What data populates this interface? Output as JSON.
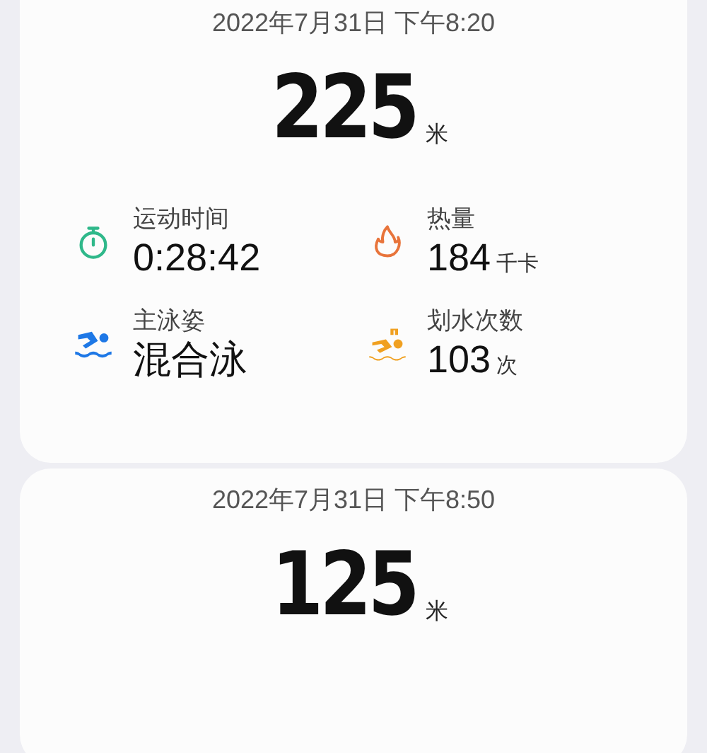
{
  "records": [
    {
      "datetime": "2022年7月31日 下午8:20",
      "distance": "225",
      "distance_unit": "米",
      "stats": [
        {
          "kind": "stopwatch",
          "label": "运动时间",
          "value": "0:28:42"
        },
        {
          "kind": "flame",
          "label": "热量",
          "value": "184",
          "unit": "千卡"
        },
        {
          "kind": "swimmer",
          "label": "主泳姿",
          "value": "混合泳"
        },
        {
          "kind": "strokes",
          "label": "划水次数",
          "value": "103",
          "unit": "次"
        }
      ]
    },
    {
      "datetime": "2022年7月31日 下午8:50",
      "distance": "125",
      "distance_unit": "米"
    }
  ]
}
